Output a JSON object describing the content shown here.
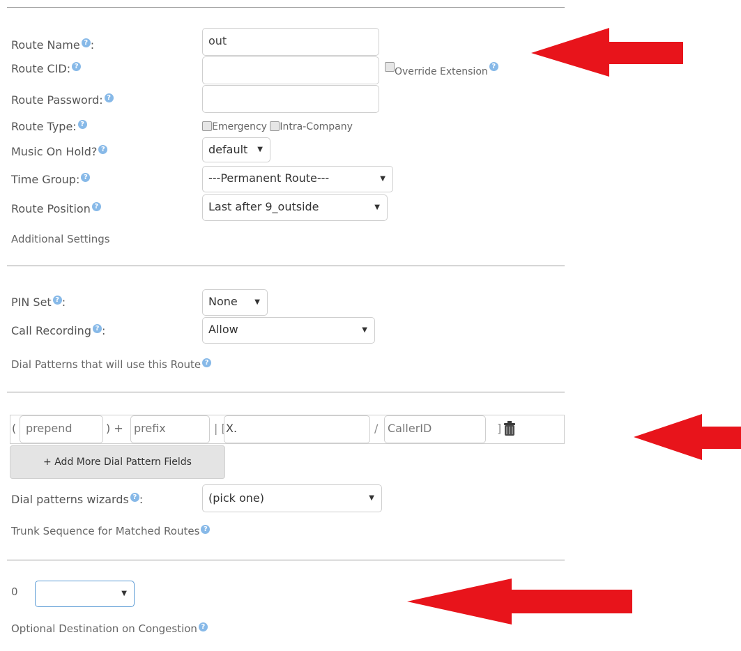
{
  "route": {
    "name_label": "Route Name",
    "name_colon": ":",
    "name_value": "out",
    "cid_label": "Route CID:",
    "override_label": "Override Extension",
    "password_label": "Route Password:",
    "type_label": "Route Type:",
    "emergency_label": "Emergency",
    "intra_company_label": "Intra-Company",
    "moh_label": "Music On Hold?",
    "moh_value": "default",
    "time_group_label": "Time Group:",
    "time_group_value": "---Permanent Route---",
    "position_label": "Route Position",
    "position_value": "Last after 9_outside"
  },
  "sections": {
    "additional": "Additional Settings",
    "dial_patterns": "Dial Patterns that will use this Route",
    "trunk_sequence": "Trunk Sequence for Matched Routes",
    "congestion": "Optional Destination on Congestion"
  },
  "additional": {
    "pin_label": "PIN Set",
    "pin_colon": ":",
    "pin_value": "None",
    "recording_label": "Call Recording",
    "recording_colon": ":",
    "recording_value": "Allow"
  },
  "dial_pattern": {
    "open_paren": "(",
    "prepend_placeholder": "prepend",
    "close_plus": ") +",
    "prefix_placeholder": "prefix",
    "bar_bracket": "| [",
    "match_placeholder": "X.",
    "slash": "/",
    "callerid_placeholder": "CallerID",
    "close_bracket": "]",
    "add_button": "+ Add More Dial Pattern Fields",
    "wizard_label": "Dial patterns wizards",
    "wizard_colon": ":",
    "wizard_value": "(pick one)"
  },
  "trunk": {
    "index": "0",
    "value": ""
  },
  "icons": {
    "help": "question-circle-icon",
    "trash": "trash-icon",
    "arrow": "red-arrow"
  },
  "colors": {
    "help_icon": "#87b9e8",
    "arrow": "#e8141b",
    "focus_border": "#5b9bd5"
  }
}
